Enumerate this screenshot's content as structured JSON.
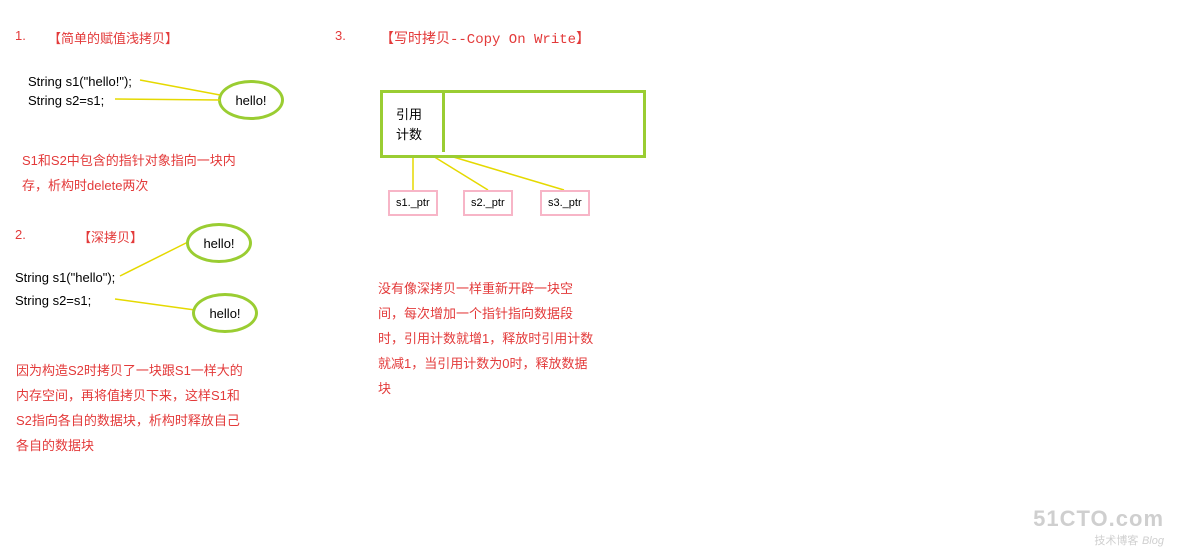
{
  "section1": {
    "num": "1.",
    "title": "【简单的赋值浅拷贝】",
    "code1": "String s1(\"hello!\");",
    "code2": "String s2=s1;",
    "bubble": "hello!",
    "desc_l1": "S1和S2中包含的指针对象指向一块内",
    "desc_l2": "存，析构时delete两次"
  },
  "section2": {
    "num": "2.",
    "title": "【深拷贝】",
    "code1": "String s1(\"hello\");",
    "code2": "String s2=s1;",
    "bubble1": "hello!",
    "bubble2": "hello!",
    "desc_l1": "因为构造S2时拷贝了一块跟S1一样大的",
    "desc_l2": "内存空间，再将值拷贝下来，这样S1和",
    "desc_l3": "S2指向各自的数据块，析构时释放自己",
    "desc_l4": "各自的数据块"
  },
  "section3": {
    "num": "3.",
    "title": "【写时拷贝--Copy On Write】",
    "box_l1": "引用",
    "box_l2": "计数",
    "ptr1": "s1._ptr",
    "ptr2": "s2._ptr",
    "ptr3": "s3._ptr",
    "desc_l1": "没有像深拷贝一样重新开辟一块空",
    "desc_l2": "间，每次增加一个指针指向数据段",
    "desc_l3": "时，引用计数就增1，释放时引用计数",
    "desc_l4": "就减1，当引用计数为0时，释放数据",
    "desc_l5": "块"
  },
  "watermark": {
    "line1": "51CTO.com",
    "line2": "技术博客",
    "line3": "Blog"
  }
}
